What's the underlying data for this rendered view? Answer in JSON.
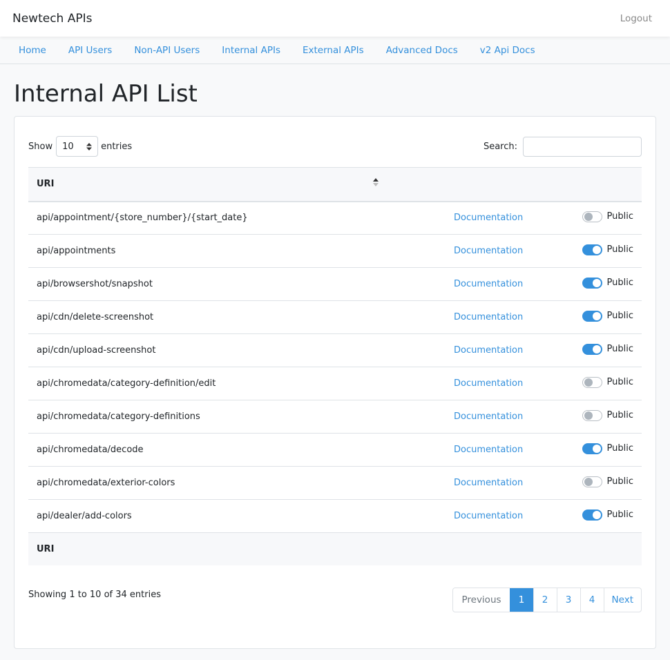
{
  "app": {
    "brand": "Newtech APIs",
    "logout_label": "Logout"
  },
  "nav": {
    "items": [
      {
        "label": "Home"
      },
      {
        "label": "API Users"
      },
      {
        "label": "Non-API Users"
      },
      {
        "label": "Internal APIs"
      },
      {
        "label": "External APIs"
      },
      {
        "label": "Advanced Docs"
      },
      {
        "label": "v2 Api Docs"
      }
    ]
  },
  "page": {
    "title": "Internal API List"
  },
  "controls": {
    "show_label": "Show",
    "entries_label": "entries",
    "page_length": "10",
    "search_label": "Search:",
    "search_value": ""
  },
  "table": {
    "header": {
      "uri": "URI"
    },
    "footer": {
      "uri": "URI"
    },
    "rows": [
      {
        "uri": "api/appointment/{store_number}/{start_date}",
        "doc": "Documentation",
        "public": false,
        "public_label": "Public"
      },
      {
        "uri": "api/appointments",
        "doc": "Documentation",
        "public": true,
        "public_label": "Public"
      },
      {
        "uri": "api/browsershot/snapshot",
        "doc": "Documentation",
        "public": true,
        "public_label": "Public"
      },
      {
        "uri": "api/cdn/delete-screenshot",
        "doc": "Documentation",
        "public": true,
        "public_label": "Public"
      },
      {
        "uri": "api/cdn/upload-screenshot",
        "doc": "Documentation",
        "public": true,
        "public_label": "Public"
      },
      {
        "uri": "api/chromedata/category-definition/edit",
        "doc": "Documentation",
        "public": false,
        "public_label": "Public"
      },
      {
        "uri": "api/chromedata/category-definitions",
        "doc": "Documentation",
        "public": false,
        "public_label": "Public"
      },
      {
        "uri": "api/chromedata/decode",
        "doc": "Documentation",
        "public": true,
        "public_label": "Public"
      },
      {
        "uri": "api/chromedata/exterior-colors",
        "doc": "Documentation",
        "public": false,
        "public_label": "Public"
      },
      {
        "uri": "api/dealer/add-colors",
        "doc": "Documentation",
        "public": true,
        "public_label": "Public"
      }
    ]
  },
  "footer": {
    "info": "Showing 1 to 10 of 34 entries",
    "pagination": {
      "previous": "Previous",
      "pages": [
        "1",
        "2",
        "3",
        "4"
      ],
      "current": "1",
      "next": "Next"
    }
  },
  "colors": {
    "accent": "#3490dc",
    "toggle_off": "#adb5bd"
  }
}
